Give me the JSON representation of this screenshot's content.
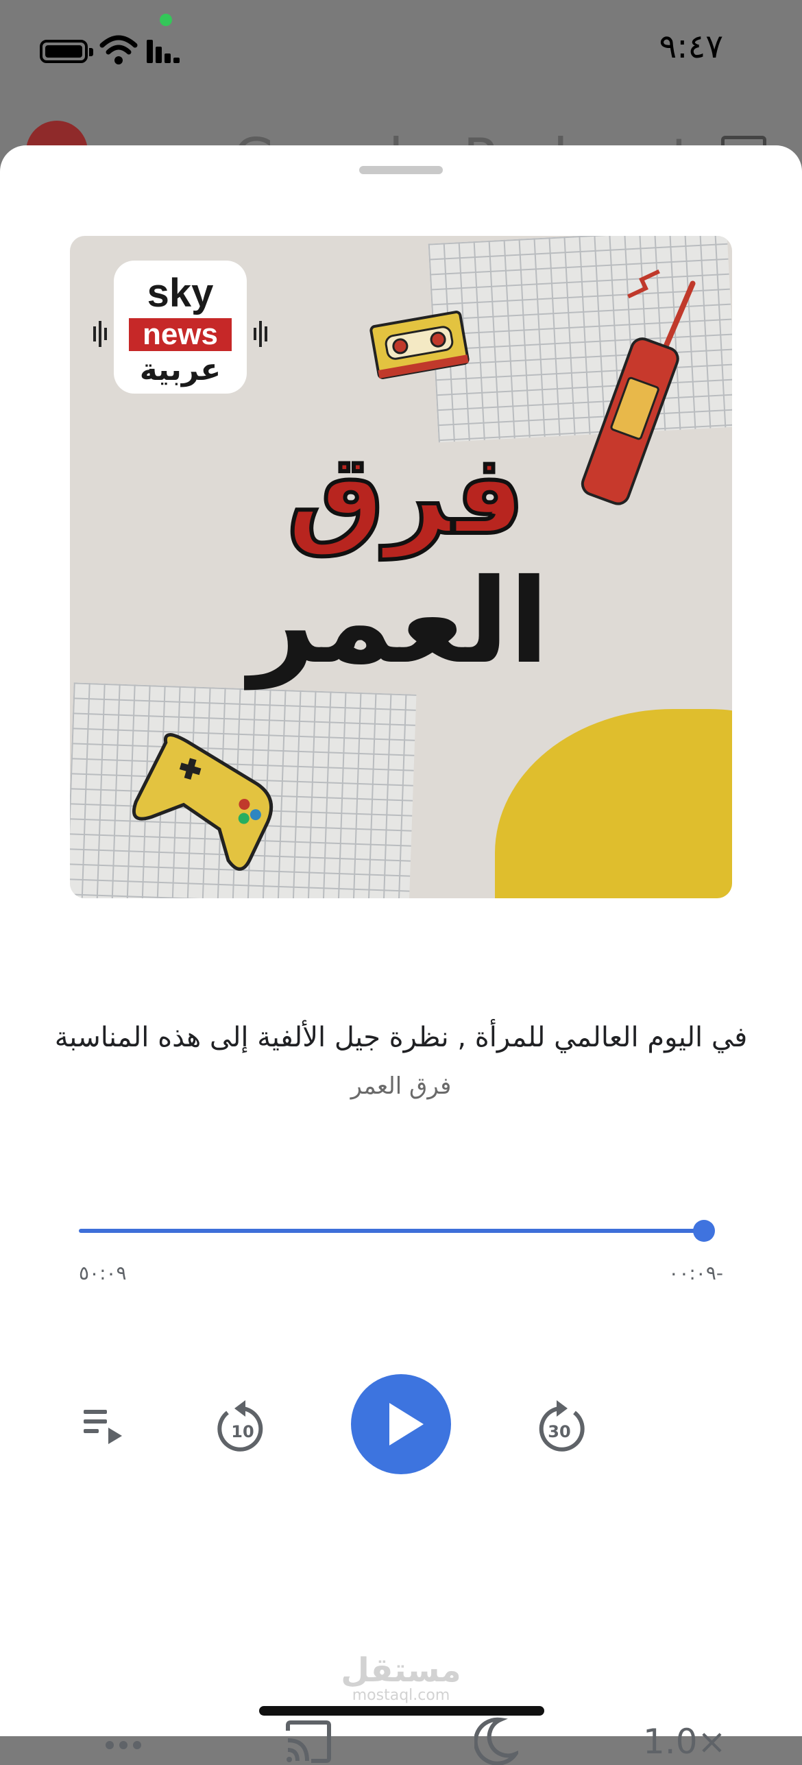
{
  "status_bar": {
    "time": "٩:٤٧"
  },
  "background_app": {
    "title_peek": "Google Podcasts"
  },
  "artwork": {
    "logo_top": "sky",
    "logo_middle": "news",
    "logo_bottom": "عربية",
    "title_line_1": "فرق",
    "title_line_2": "العمر"
  },
  "episode": {
    "title": "في اليوم العالمي للمرأة , نظرة جيل الألفية إلى هذه المناسبة",
    "podcast": "فرق العمر"
  },
  "player": {
    "progress_fraction": 1.0,
    "elapsed": "٥٠:٠٩",
    "remaining": "-٠٠:٠٩",
    "rewind_seconds": "10",
    "forward_seconds": "30"
  },
  "toolbar": {
    "speed": "1.0×"
  },
  "watermark": {
    "arabic": "مستقل",
    "latin": "mostaql.com"
  },
  "colors": {
    "accent": "#3d74df",
    "artwork_red": "#b8251f",
    "artwork_yellow": "#dfbe2d"
  },
  "icons": [
    "battery-icon",
    "wifi-icon",
    "signal-icon",
    "queue-icon",
    "rewind-10-icon",
    "play-icon",
    "forward-30-icon",
    "more-icon",
    "cast-icon",
    "sleep-timer-icon"
  ]
}
